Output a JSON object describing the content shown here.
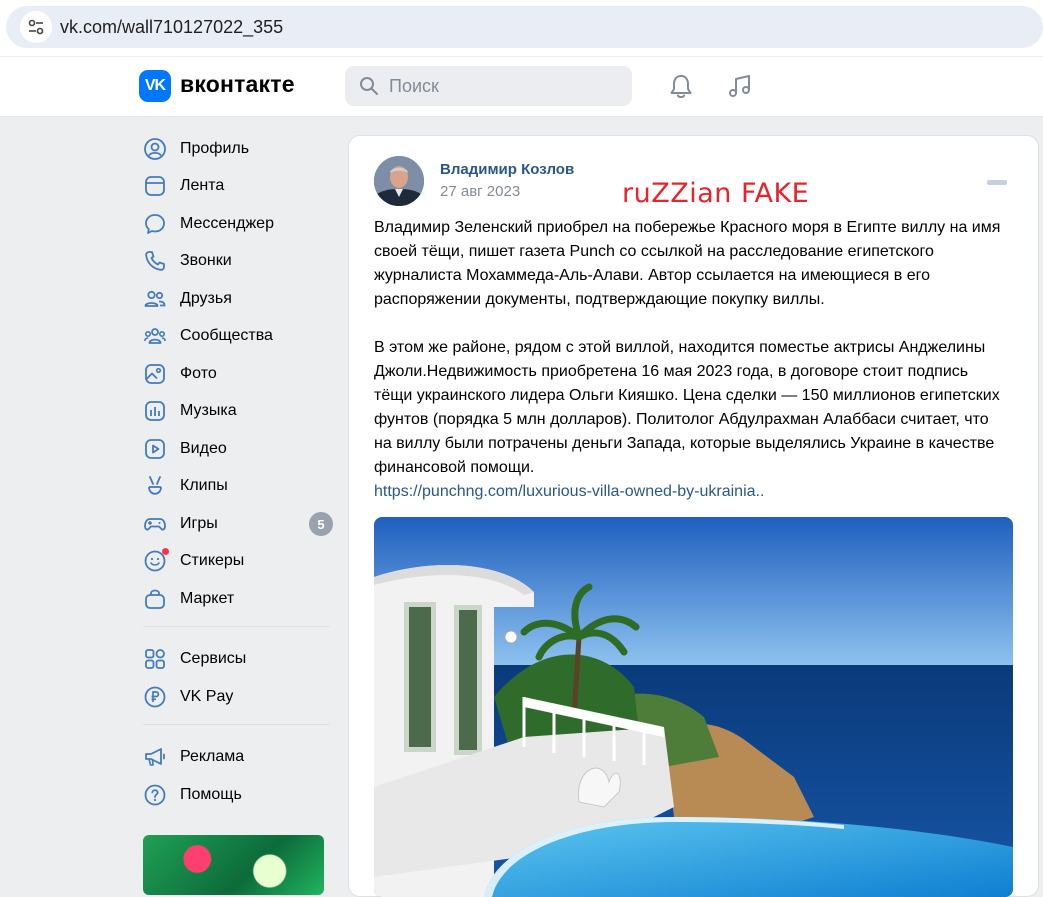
{
  "browser": {
    "url": "vk.com/wall710127022_355"
  },
  "header": {
    "logo_text": "VK",
    "wordmark": "вконтакте",
    "search_placeholder": "Поиск"
  },
  "sidebar": {
    "items": [
      {
        "label": "Профиль",
        "icon": "profile-icon"
      },
      {
        "label": "Лента",
        "icon": "feed-icon"
      },
      {
        "label": "Мессенджер",
        "icon": "messenger-icon"
      },
      {
        "label": "Звонки",
        "icon": "phone-icon"
      },
      {
        "label": "Друзья",
        "icon": "friends-icon"
      },
      {
        "label": "Сообщества",
        "icon": "communities-icon"
      },
      {
        "label": "Фото",
        "icon": "photo-icon"
      },
      {
        "label": "Музыка",
        "icon": "music-icon"
      },
      {
        "label": "Видео",
        "icon": "video-icon"
      },
      {
        "label": "Клипы",
        "icon": "clips-icon"
      },
      {
        "label": "Игры",
        "icon": "games-icon",
        "badge": "5"
      },
      {
        "label": "Стикеры",
        "icon": "stickers-icon"
      },
      {
        "label": "Маркет",
        "icon": "market-icon"
      }
    ],
    "services": [
      {
        "label": "Сервисы",
        "icon": "services-icon"
      },
      {
        "label": "VK Pay",
        "icon": "vkpay-icon"
      }
    ],
    "footer": [
      {
        "label": "Реклама",
        "icon": "ads-icon"
      },
      {
        "label": "Помощь",
        "icon": "help-icon"
      }
    ]
  },
  "post": {
    "author": "Владимир Козлов",
    "date": "27 авг 2023",
    "overlay_stamp": "ruZZian FAKE",
    "paragraph1": "Владимир Зеленский приобрел на побережье Красного моря в Египте виллу на имя своей тёщи, пишет газета Punch со ссылкой на расследование египетского журналиста Мохаммеда-Аль-Алави. Автор ссылается на имеющиеся в его распоряжении документы, подтверждающие покупку виллы.",
    "paragraph2": "В этом же районе, рядом с этой виллой, находится поместье актрисы Анджелины Джоли.Недвижимость приобретена 16 мая 2023 года, в договоре стоит подпись тёщи украинского лидера Ольги Кияшко. Цена сделки — 150 миллионов египетских фунтов (порядка 5 млн долларов). Политолог Абдулрахман Алаббаси считает, что на виллу были потрачены деньги Запада, которые выделялись Украине в качестве финансовой помощи.",
    "link": "https://punchng.com/luxurious-villa-owned-by-ukrainia.."
  },
  "colors": {
    "vk_blue": "#0077ff",
    "link": "#2a5885",
    "stamp_red": "#e8232a",
    "badge_grey": "#99a2ad"
  }
}
